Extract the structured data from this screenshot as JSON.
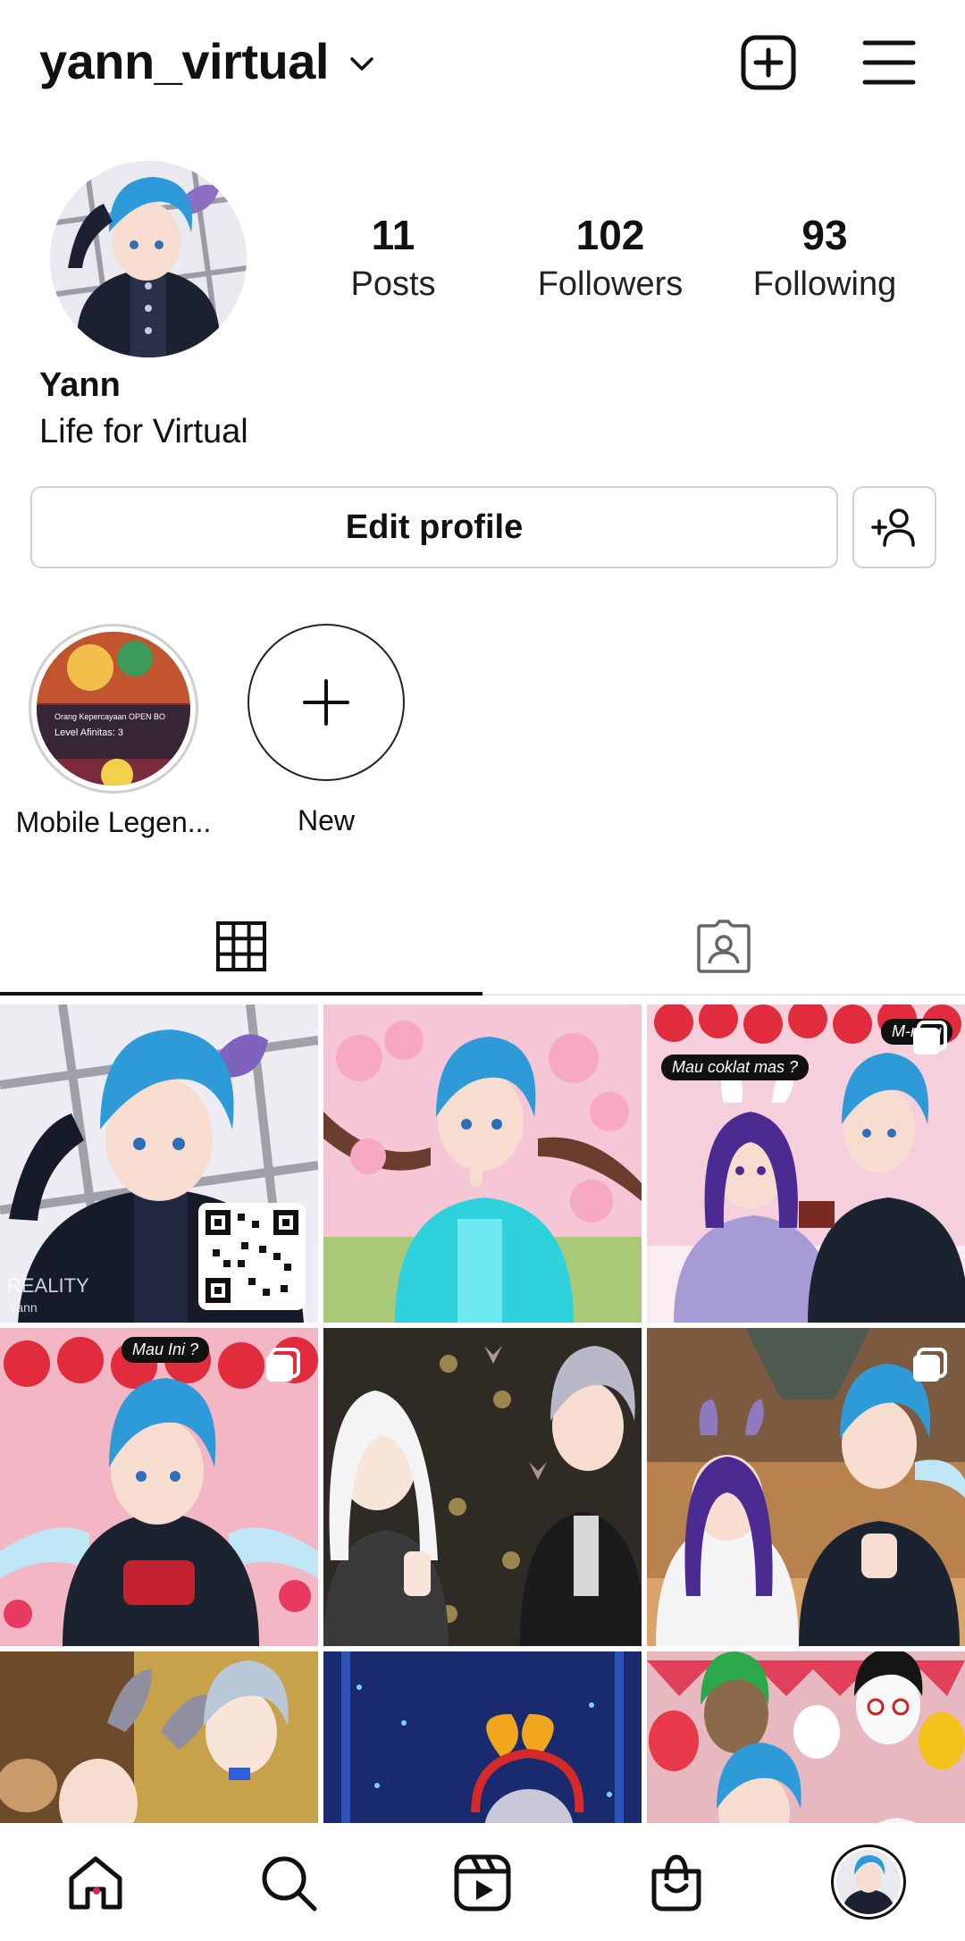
{
  "header": {
    "username": "yann_virtual",
    "icons": [
      "chevron-down-icon",
      "new-post-icon",
      "menu-icon"
    ]
  },
  "profile": {
    "display_name": "Yann",
    "bio": "Life for Virtual",
    "stats": [
      {
        "value": "11",
        "label": "Posts"
      },
      {
        "value": "102",
        "label": "Followers"
      },
      {
        "value": "93",
        "label": "Following"
      }
    ]
  },
  "actions": {
    "edit_profile": "Edit profile",
    "discover_icon": "add-person-icon"
  },
  "highlights": [
    {
      "label": "Mobile Legen...",
      "overlay_line1": "Orang Kepercayaan OPEN BO",
      "overlay_line2": "Level Afinitas: 3"
    },
    {
      "label": "New"
    }
  ],
  "tabs": [
    {
      "name": "posts-grid",
      "icon": "grid-icon",
      "active": true
    },
    {
      "name": "tagged",
      "icon": "tagged-person-icon",
      "active": false
    }
  ],
  "posts": {
    "bubbles": {
      "p3_a": "M-mau",
      "p3_b": "Mau coklat mas ?",
      "p4": "Mau Ini ?"
    },
    "watermark": "REALITY",
    "watermark_user": "Yann"
  },
  "nav": [
    "home-icon",
    "search-icon",
    "reels-icon",
    "shop-icon",
    "profile-avatar"
  ],
  "colors": {
    "accent": "#e0245e",
    "text": "#111111",
    "border": "#d0d0d0"
  }
}
